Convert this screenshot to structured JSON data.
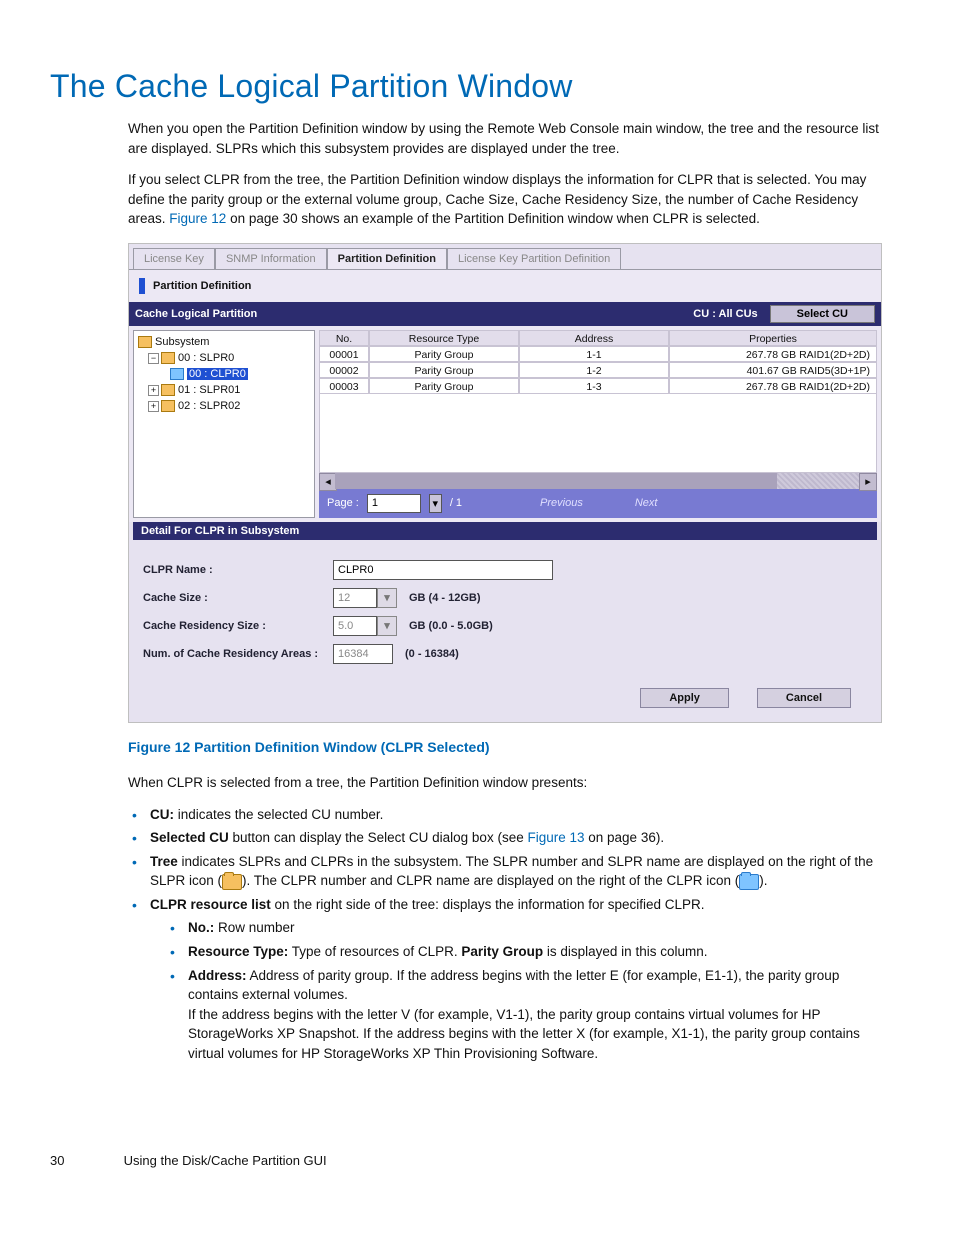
{
  "heading": "The Cache Logical Partition Window",
  "para1": "When you open the Partition Definition window by using the Remote Web Console main window, the tree and the resource list are displayed. SLPRs which this subsystem provides are displayed under the tree.",
  "para2_a": "If you select CLPR from the tree, the Partition Definition window displays the information for CLPR that is selected. You may define the parity group or the external volume group, Cache Size, Cache Residency Size, the number of Cache Residency areas. ",
  "para2_link": "Figure 12",
  "para2_b": " on page 30 shows an example of the Partition Definition window when CLPR is selected.",
  "figure_caption": "Figure 12 Partition Definition Window (CLPR Selected)",
  "after_fig": "When CLPR is selected from a tree, the Partition Definition window presents:",
  "bullets": {
    "cu_b": "CU:",
    "cu_t": " indicates the selected CU number.",
    "sel_b": "Selected CU",
    "sel_t1": " button can display the Select CU dialog box (see ",
    "sel_link": "Figure 13",
    "sel_t2": " on page 36).",
    "tree_b": "Tree",
    "tree_t1": " indicates SLPRs and CLPRs in the subsystem. The SLPR number and SLPR name are displayed on the right of the SLPR icon (",
    "tree_t2": "). The CLPR number and CLPR name are displayed on the right of the CLPR icon (",
    "tree_t3": ").",
    "res_b": "CLPR resource list",
    "res_t": " on the right side of the tree: displays the information for specified CLPR.",
    "no_b": "No.:",
    "no_t": " Row number",
    "rt_b": "Resource Type:",
    "rt_t1": " Type of resources of CLPR. ",
    "rt_b2": "Parity Group",
    "rt_t2": " is displayed in this column.",
    "ad_b": "Address:",
    "ad_t": " Address of parity group. If the address begins with the letter E (for example, E1-1), the parity group contains external volumes.",
    "ad_t2": "If the address begins with the letter V (for example, V1-1), the parity group contains virtual volumes for HP StorageWorks XP Snapshot. If the address begins with the letter X (for example, X1-1), the parity group contains virtual volumes for HP StorageWorks XP Thin Provisioning Software."
  },
  "footer_page": "30",
  "footer_text": "Using the Disk/Cache Partition GUI",
  "ui": {
    "tabs": [
      "License Key",
      "SNMP Information",
      "Partition Definition",
      "License Key Partition Definition"
    ],
    "title": "Partition Definition",
    "strip_left": "Cache Logical Partition",
    "strip_cu": "CU : All CUs",
    "strip_btn": "Select CU",
    "tree": {
      "root": "Subsystem",
      "n1": "00 : SLPR0",
      "n1a": "00 : CLPR0",
      "n2": "01 : SLPR01",
      "n3": "02 : SLPR02"
    },
    "cols": {
      "no": "No.",
      "rt": "Resource Type",
      "ad": "Address",
      "pr": "Properties"
    },
    "rows": [
      {
        "no": "00001",
        "rt": "Parity Group",
        "ad": "1-1",
        "pr": "267.78 GB RAID1(2D+2D)"
      },
      {
        "no": "00002",
        "rt": "Parity Group",
        "ad": "1-2",
        "pr": "401.67 GB RAID5(3D+1P)"
      },
      {
        "no": "00003",
        "rt": "Parity Group",
        "ad": "1-3",
        "pr": "267.78 GB RAID1(2D+2D)"
      }
    ],
    "page_lbl": "Page :",
    "page_cur": "1",
    "page_of": "/ 1",
    "prev": "Previous",
    "next": "Next",
    "strip2": "Detail For CLPR in Subsystem",
    "d_name_l": "CLPR Name :",
    "d_name_v": "CLPR0",
    "d_cache_l": "Cache Size :",
    "d_cache_v": "12",
    "d_cache_s": "GB (4 - 12GB)",
    "d_res_l": "Cache Residency Size :",
    "d_res_v": "5.0",
    "d_res_s": "GB (0.0 - 5.0GB)",
    "d_num_l": "Num. of Cache Residency Areas :",
    "d_num_v": "16384",
    "d_num_s": "(0 - 16384)",
    "apply": "Apply",
    "cancel": "Cancel"
  }
}
